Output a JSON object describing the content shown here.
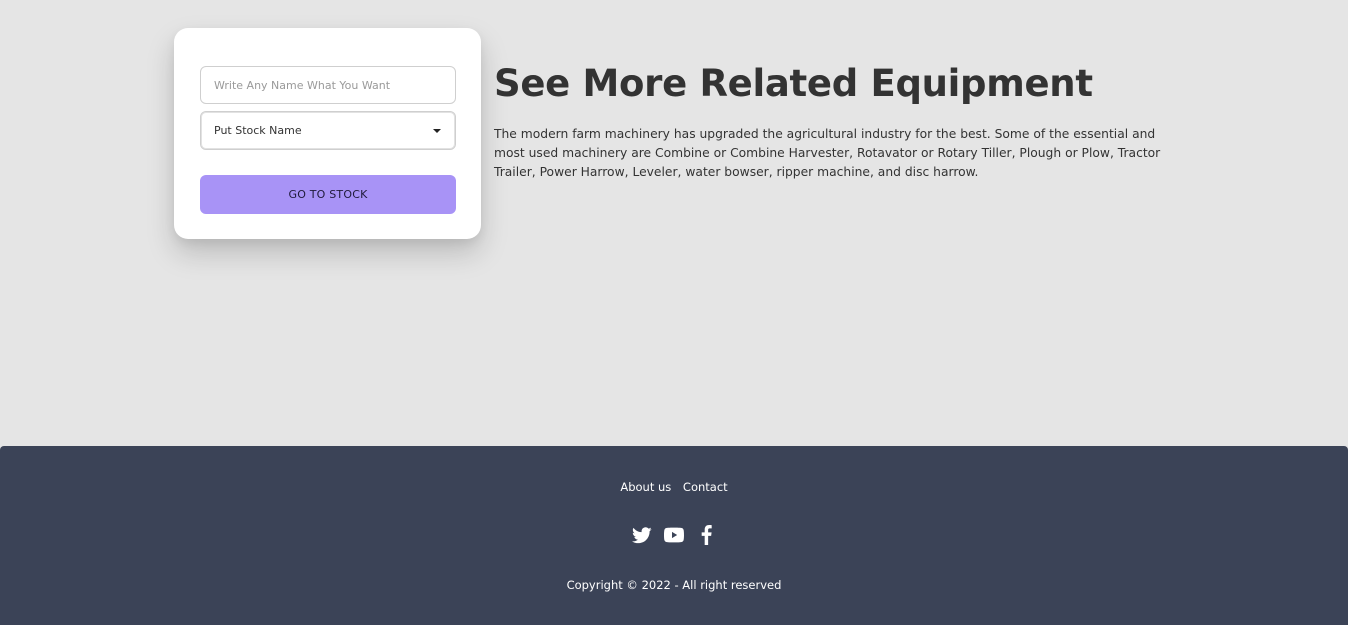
{
  "form": {
    "name_placeholder": "Write Any Name What You Want",
    "stock_select_value": "Put Stock Name",
    "submit_label": "GO TO STOCK"
  },
  "content": {
    "title": "See More Related Equipment",
    "description": "The modern farm machinery has upgraded the agricultural industry for the best. Some of the essential and most used machinery are Combine or Combine Harvester, Rotavator or Rotary Tiller, Plough or Plow, Tractor Trailer, Power Harrow, Leveler, water bowser, ripper machine, and disc harrow."
  },
  "footer": {
    "links": [
      "About us",
      "Contact"
    ],
    "social_icons": [
      "twitter-icon",
      "youtube-icon",
      "facebook-icon"
    ],
    "copyright": "Copyright © 2022 - All right reserved"
  },
  "colors": {
    "page_bg": "#e5e5e5",
    "card_bg": "#ffffff",
    "button_bg": "#a893f6",
    "footer_bg": "#3b4357",
    "heading_text": "#333333"
  }
}
